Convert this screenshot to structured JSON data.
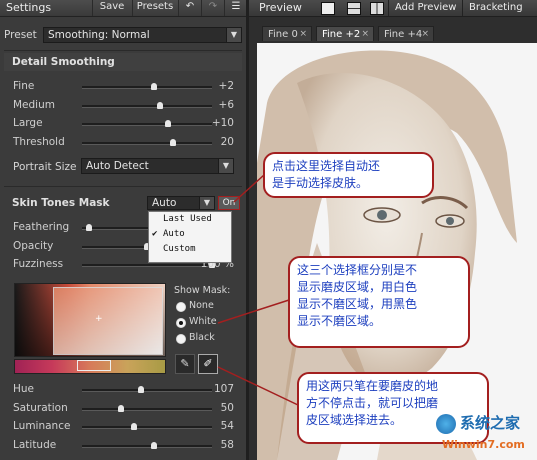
{
  "toolbar": {
    "settings_title": "Settings",
    "save_label": "Save",
    "presets_label": "Presets"
  },
  "preset": {
    "label": "Preset",
    "value": "Smoothing: Normal"
  },
  "detail_smoothing": {
    "title": "Detail Smoothing",
    "sliders": [
      {
        "label": "Fine",
        "value": "+2",
        "level": 0.55
      },
      {
        "label": "Medium",
        "value": "+6",
        "level": 0.6
      },
      {
        "label": "Large",
        "value": "+10",
        "level": 0.66
      },
      {
        "label": "Threshold",
        "value": "20",
        "level": 0.7
      }
    ],
    "portrait_size_label": "Portrait Size",
    "portrait_size_value": "Auto Detect"
  },
  "skin_tones_mask": {
    "title": "Skin Tones Mask",
    "mode_value": "Auto",
    "on_label": "On",
    "menu_options": [
      "Last Used",
      "Auto",
      "Custom"
    ],
    "menu_checked": "Auto",
    "sliders": [
      {
        "label": "Feathering",
        "value": "",
        "level": 0.05
      },
      {
        "label": "Opacity",
        "value": "",
        "level": 0.5
      },
      {
        "label": "Fuzziness",
        "value": "100 %",
        "level": 1.0
      }
    ],
    "show_mask_label": "Show Mask:",
    "show_mask_options": [
      "None",
      "White",
      "Black"
    ],
    "show_mask_selected": "White",
    "hsl_sliders": [
      {
        "label": "Hue",
        "value": "107",
        "level": 0.45
      },
      {
        "label": "Saturation",
        "value": "50",
        "level": 0.3
      },
      {
        "label": "Luminance",
        "value": "54",
        "level": 0.4
      },
      {
        "label": "Latitude",
        "value": "58",
        "level": 0.55
      }
    ]
  },
  "preview": {
    "title": "Preview",
    "add_preview_label": "Add Preview",
    "bracketing_label": "Bracketing",
    "tabs": [
      "Fine 0",
      "Fine +2",
      "Fine +4"
    ],
    "active_tab": "Fine +2"
  },
  "annotations": {
    "callout1": [
      "点击这里选择自动还",
      "是手动选择皮肤。"
    ],
    "callout2": [
      "这三个选择框分别是不",
      "显示磨皮区域，用白色",
      "显示不磨区域，用黑色",
      "显示不磨区域。"
    ],
    "callout3": [
      "用这两只笔在要磨皮的地",
      "方不停点击，就可以把磨",
      "皮区域选择进去。"
    ]
  },
  "watermark": {
    "site_name": "系统之家",
    "url": "Winwin7.com"
  },
  "colors": {
    "callout_border": "#a31f1f",
    "callout_text": "#1d3fbf",
    "panel_bg": "#3b3b3b"
  }
}
